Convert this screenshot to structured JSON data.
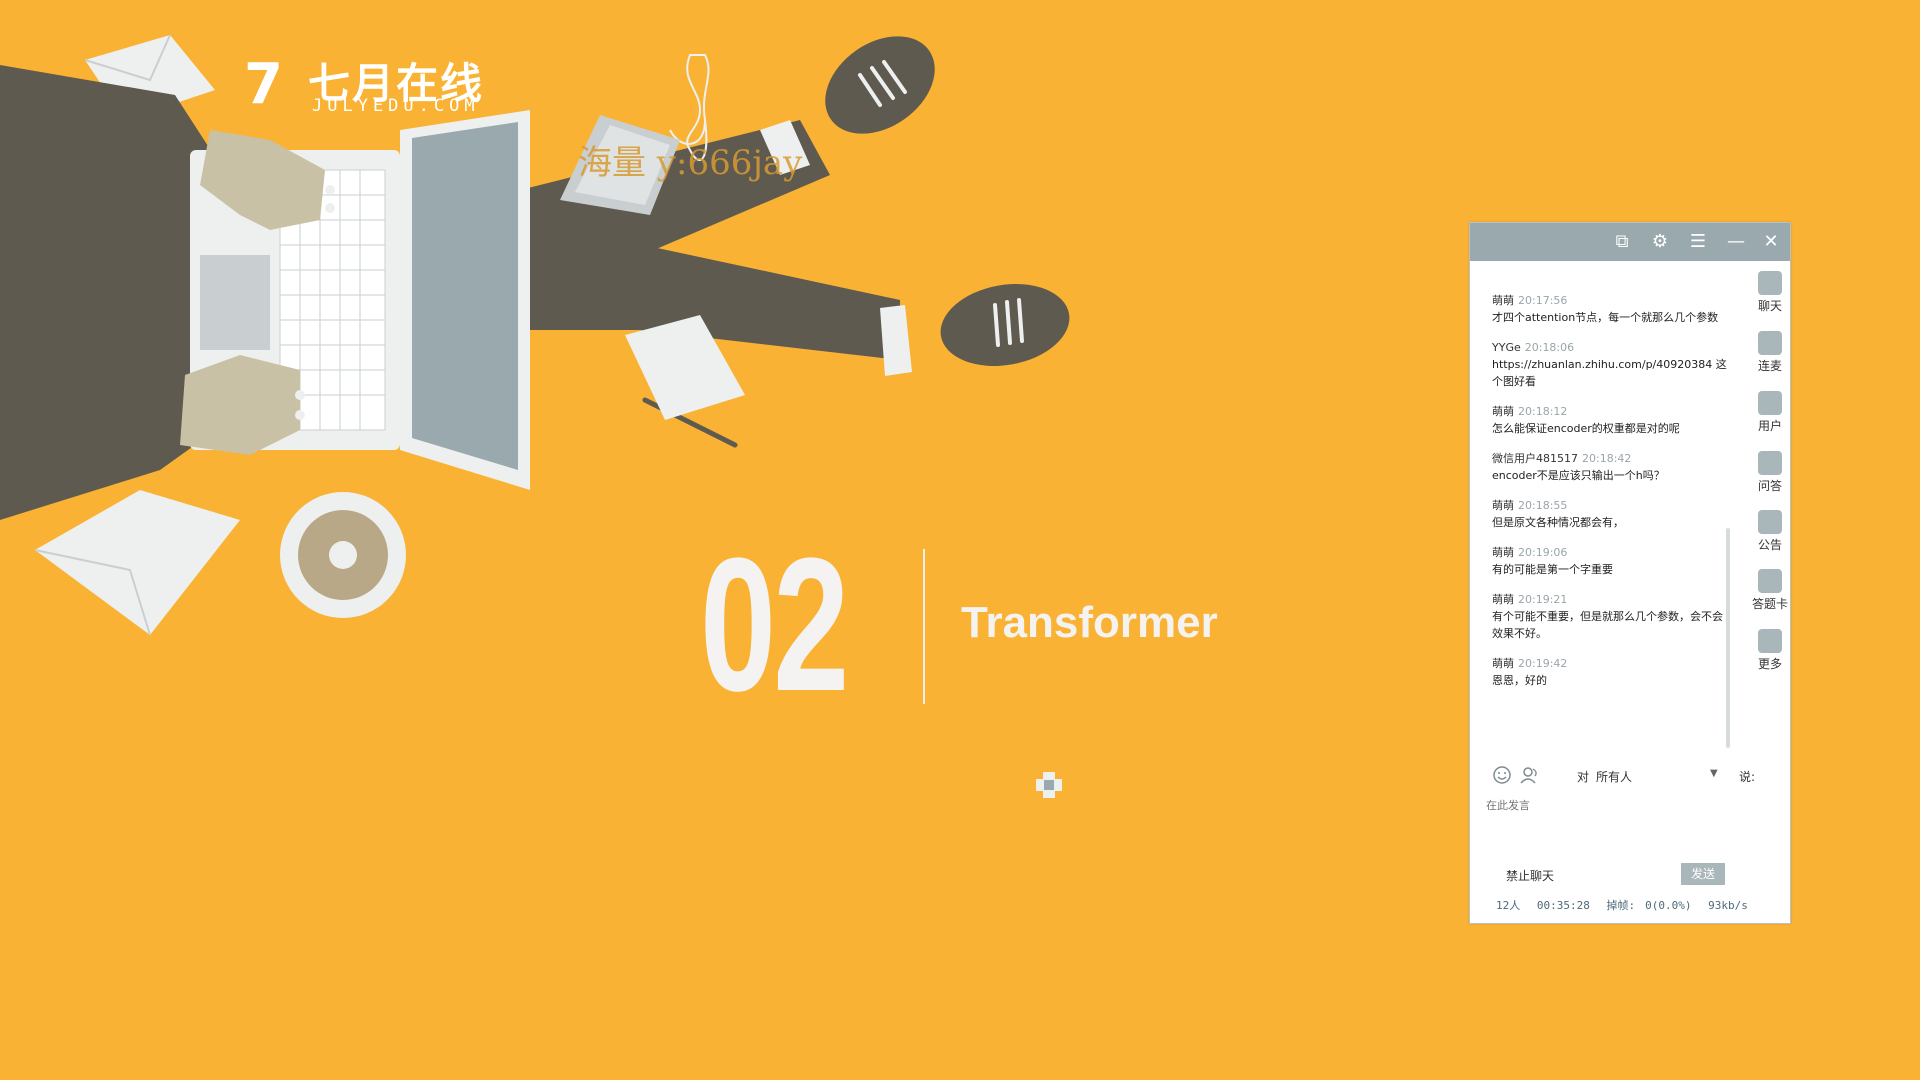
{
  "slide": {
    "logo_text": "七月在线",
    "logo_sub": "JULYEDU.COM",
    "logo_mark": "7",
    "watermark": "海量    y:666jay",
    "section_number": "02",
    "section_title": "Transformer"
  },
  "chat": {
    "messages": [
      {
        "user": "萌萌",
        "time": "20:17:56",
        "text": "才四个attention节点，每一个就那么几个参数"
      },
      {
        "user": "YYGe",
        "time": "20:18:06",
        "text": "https://zhuanlan.zhihu.com/p/40920384  这个图好看"
      },
      {
        "user": "萌萌",
        "time": "20:18:12",
        "text": "怎么能保证encoder的权重都是对的呢"
      },
      {
        "user": "微信用户481517",
        "time": "20:18:42",
        "text": "encoder不是应该只输出一个h吗？"
      },
      {
        "user": "萌萌",
        "time": "20:18:55",
        "text": "但是原文各种情况都会有，"
      },
      {
        "user": "萌萌",
        "time": "20:19:06",
        "text": "有的可能是第一个字重要"
      },
      {
        "user": "萌萌",
        "time": "20:19:21",
        "text": "有个可能不重要，但是就那么几个参数，会不会效果不好。"
      },
      {
        "user": "萌萌",
        "time": "20:19:42",
        "text": "恩恩，好的"
      }
    ],
    "sidebar": [
      "聊天",
      "连麦",
      "用户",
      "问答",
      "公告",
      "答题卡",
      "更多"
    ],
    "to_label": "对",
    "to_value": "所有人",
    "say_label": "说:",
    "input_placeholder": "在此发言",
    "ban_chat": "禁止聊天",
    "send": "发送",
    "status": {
      "people": "12人",
      "duration": "00:35:28",
      "dropped_label": "掉帧:",
      "dropped_value": "0(0.0%)",
      "bitrate": "93kb/s"
    }
  },
  "colors": {
    "background": "#f9b233",
    "titlebar": "#9aa9ad",
    "ink": "#5e5a4f",
    "paper": "#eef0ef"
  }
}
